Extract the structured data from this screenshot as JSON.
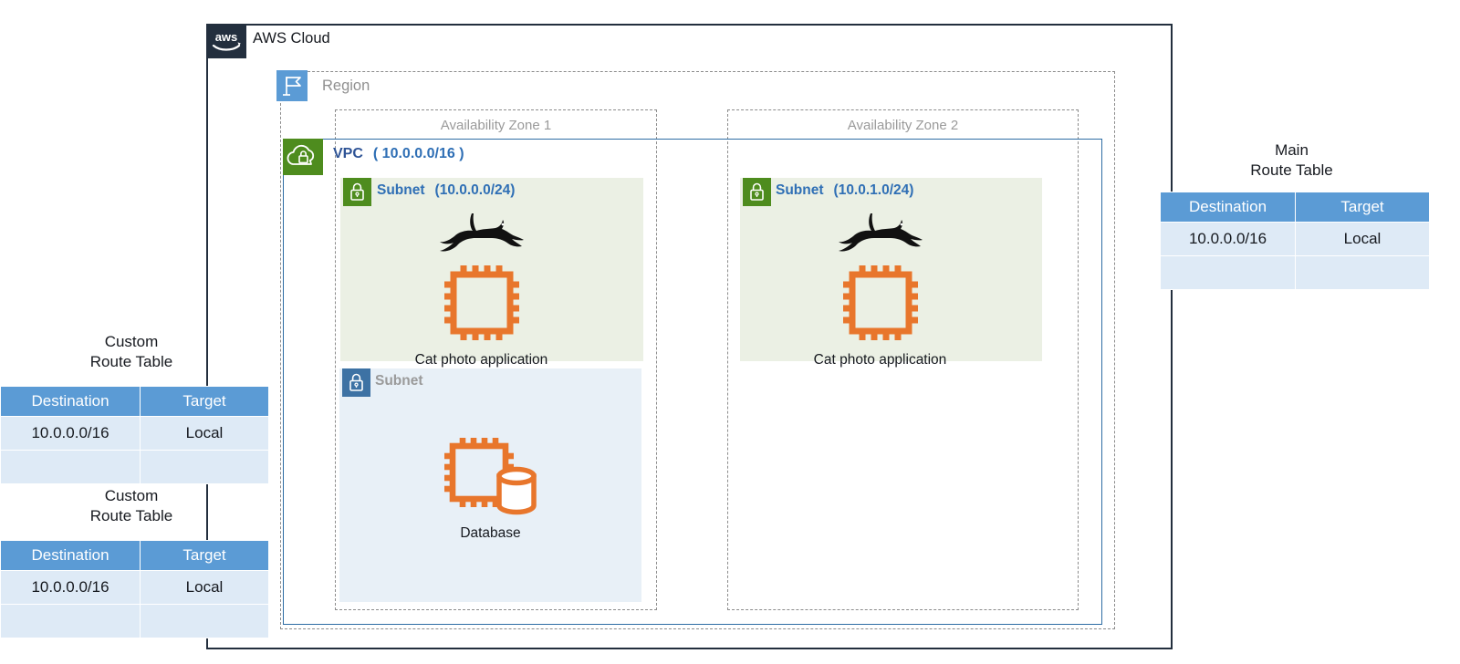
{
  "cloud": {
    "label": "AWS Cloud",
    "logo_icon": "aws-logo-icon",
    "border_color": "#232F3E"
  },
  "region": {
    "label": "Region",
    "icon": "region-flag-icon",
    "icon_color": "#5B9BD5"
  },
  "vpc": {
    "label": "VPC",
    "cidr": "( 10.0.0.0/16 )",
    "icon": "vpc-cloud-lock-icon",
    "icon_color": "#4E8C1E",
    "border_color": "#2E6DA4",
    "text_color": "#2F5496"
  },
  "availability_zones": [
    {
      "label": "Availability Zone 1"
    },
    {
      "label": "Availability Zone 2"
    }
  ],
  "subnets": [
    {
      "label": "Subnet",
      "cidr": "(10.0.0.0/24)",
      "kind": "public",
      "icon": "subnet-lock-icon",
      "icon_color": "#4E8C1E",
      "background": "#EBF0E4",
      "zone": "Availability Zone 1"
    },
    {
      "label": "Subnet",
      "cidr": "(10.0.1.0/24)",
      "kind": "public",
      "icon": "subnet-lock-icon",
      "icon_color": "#4E8C1E",
      "background": "#EBF0E4",
      "zone": "Availability Zone 2"
    },
    {
      "label": "Subnet",
      "cidr": "",
      "kind": "private",
      "icon": "subnet-lock-icon",
      "icon_color": "#3D72A4",
      "background": "#E8F0F7",
      "zone": "Availability Zone 1"
    }
  ],
  "resources": [
    {
      "caption": "Cat photo application",
      "icons": [
        "cat-icon",
        "ec2-instance-icon"
      ],
      "accent": "#E8762C",
      "zone": "Availability Zone 1"
    },
    {
      "caption": "Cat photo application",
      "icons": [
        "cat-icon",
        "ec2-instance-icon"
      ],
      "accent": "#E8762C",
      "zone": "Availability Zone 2"
    },
    {
      "caption": "Database",
      "icons": [
        "ec2-instance-icon",
        "database-cylinder-icon"
      ],
      "accent": "#E8762C",
      "zone": "Availability Zone 1"
    }
  ],
  "route_tables": [
    {
      "id": "custom-1",
      "title": "Custom\nRoute Table",
      "headers": [
        "Destination",
        "Target"
      ],
      "rows": [
        [
          "10.0.0.0/16",
          "Local"
        ],
        [
          "",
          ""
        ]
      ],
      "header_color": "#5B9BD5",
      "row_color": "#DEEAF6"
    },
    {
      "id": "custom-2",
      "title": "Custom\nRoute Table",
      "headers": [
        "Destination",
        "Target"
      ],
      "rows": [
        [
          "10.0.0.0/16",
          "Local"
        ],
        [
          "",
          ""
        ]
      ],
      "header_color": "#5B9BD5",
      "row_color": "#DEEAF6"
    },
    {
      "id": "main",
      "title": "Main\nRoute Table",
      "headers": [
        "Destination",
        "Target"
      ],
      "rows": [
        [
          "10.0.0.0/16",
          "Local"
        ],
        [
          "",
          ""
        ]
      ],
      "header_color": "#5B9BD5",
      "row_color": "#DEEAF6"
    }
  ],
  "connectors": [
    {
      "name": "custom-route-table-1-to-public-subnet-1",
      "color": "#4A90D9"
    },
    {
      "name": "custom-route-table-2-to-private-subnet-1",
      "color": "#4A90D9"
    },
    {
      "name": "main-route-table-to-vpc",
      "color": "#4A90D9"
    }
  ]
}
